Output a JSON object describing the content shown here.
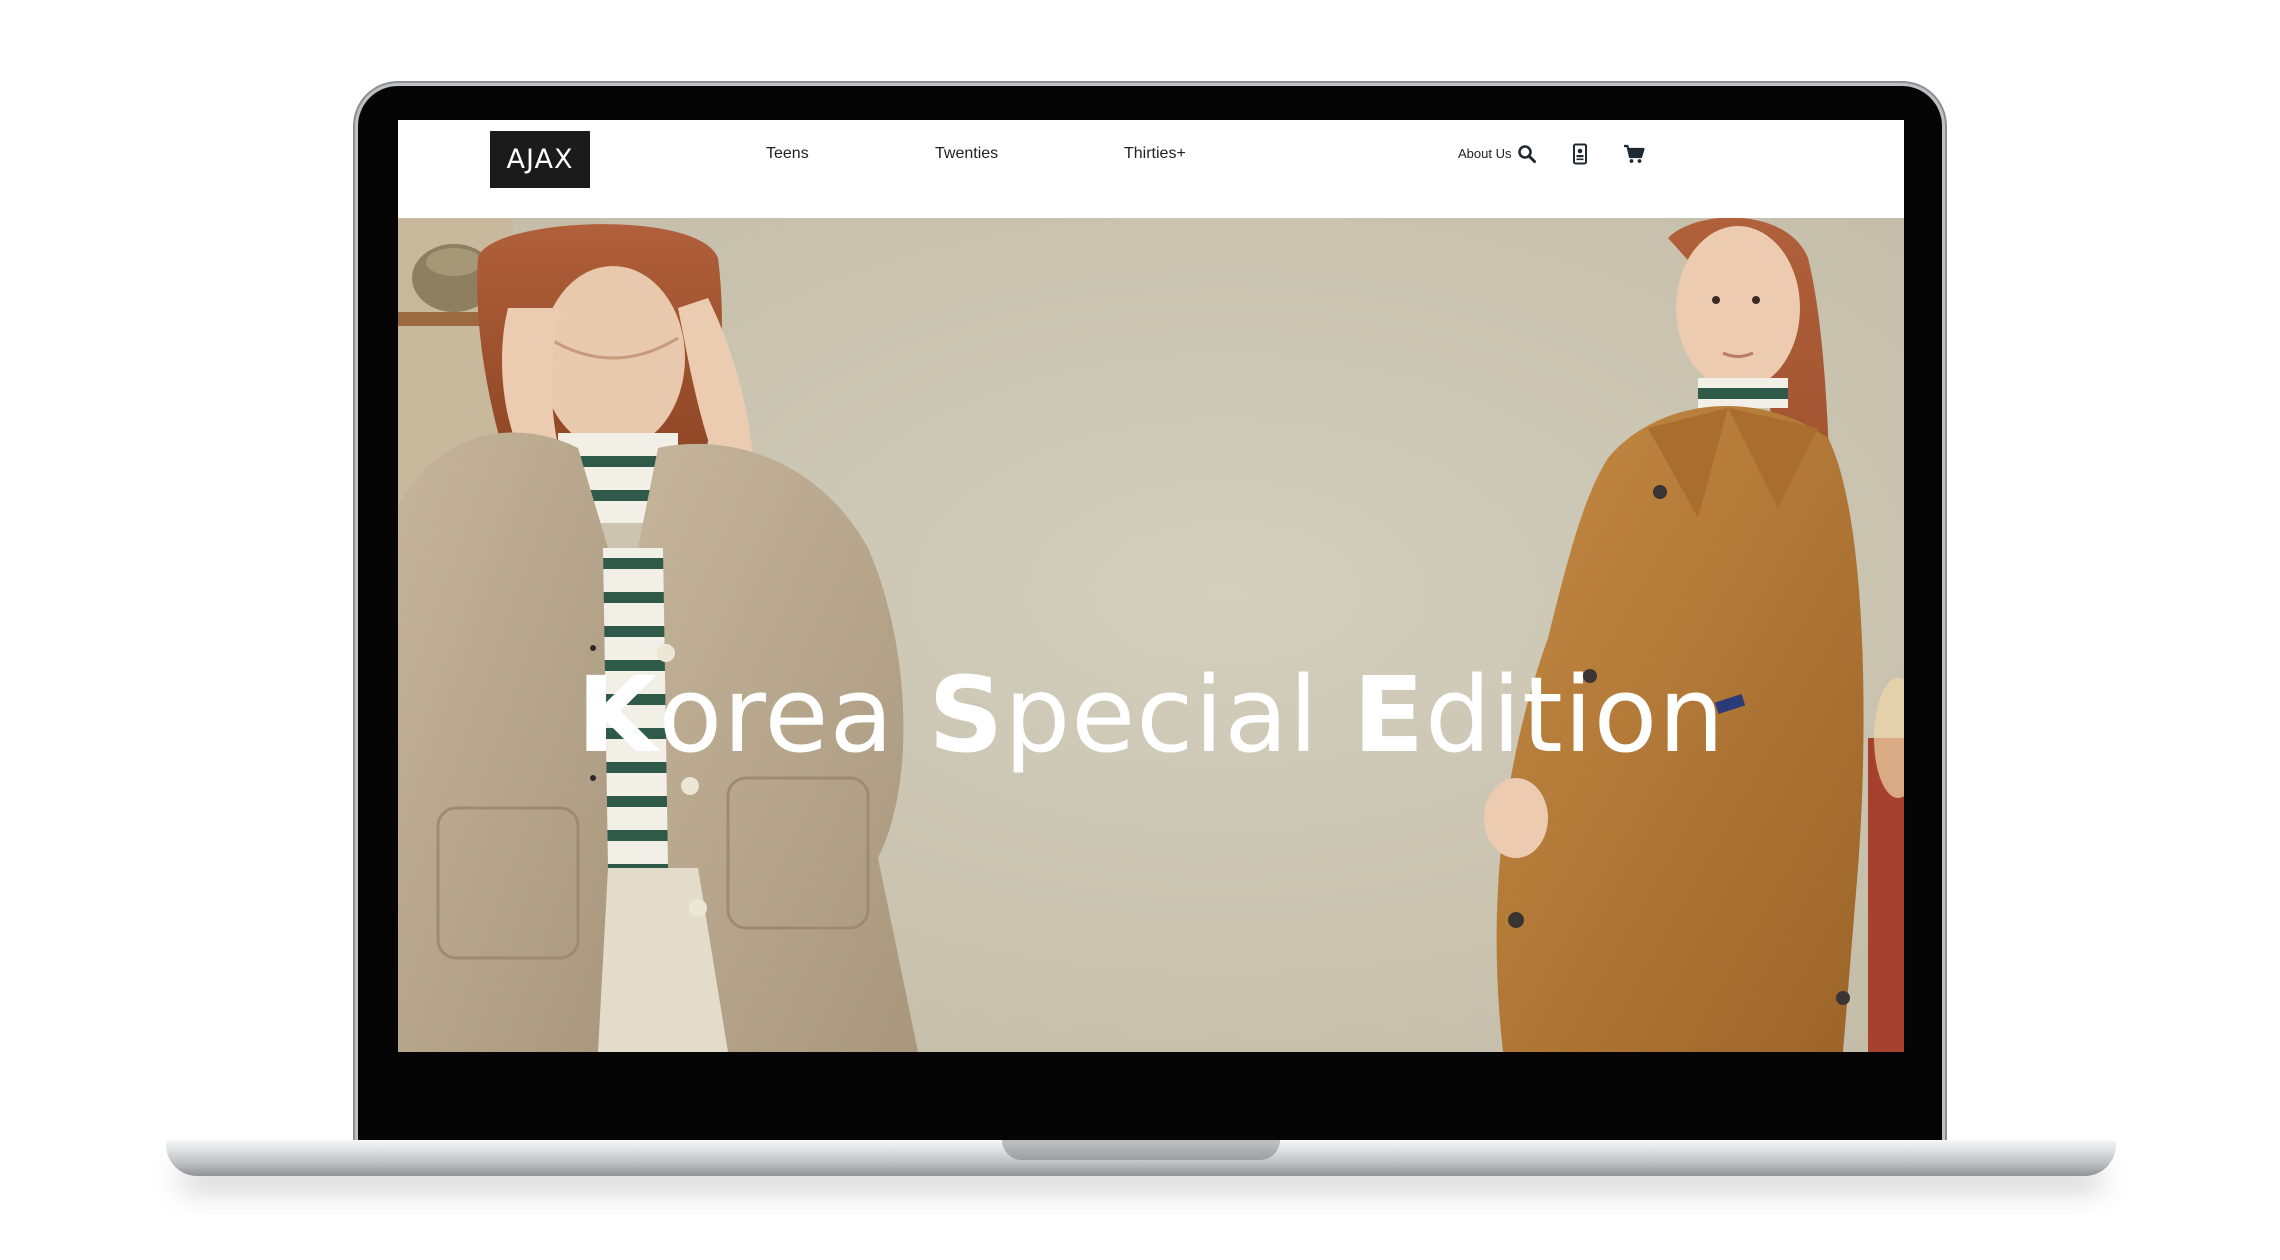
{
  "brand": {
    "logo_text": "AJAX"
  },
  "nav": {
    "items": [
      {
        "label": "Teens"
      },
      {
        "label": "Twenties"
      },
      {
        "label": "Thirties+"
      }
    ],
    "about_label": "About Us"
  },
  "icons": {
    "search": "search-icon",
    "account": "id-card-icon",
    "cart": "cart-icon"
  },
  "hero": {
    "title_parts": [
      {
        "cap": "K",
        "rest": "orea "
      },
      {
        "cap": "S",
        "rest": "pecial "
      },
      {
        "cap": "E",
        "rest": "dition"
      }
    ]
  },
  "colors": {
    "logo_bg": "#1b1b1b",
    "hero_bg": "#cdc8b5",
    "left_coat": "#b9a98f",
    "right_coat": "#b77a34",
    "hair": "#a5512a"
  }
}
